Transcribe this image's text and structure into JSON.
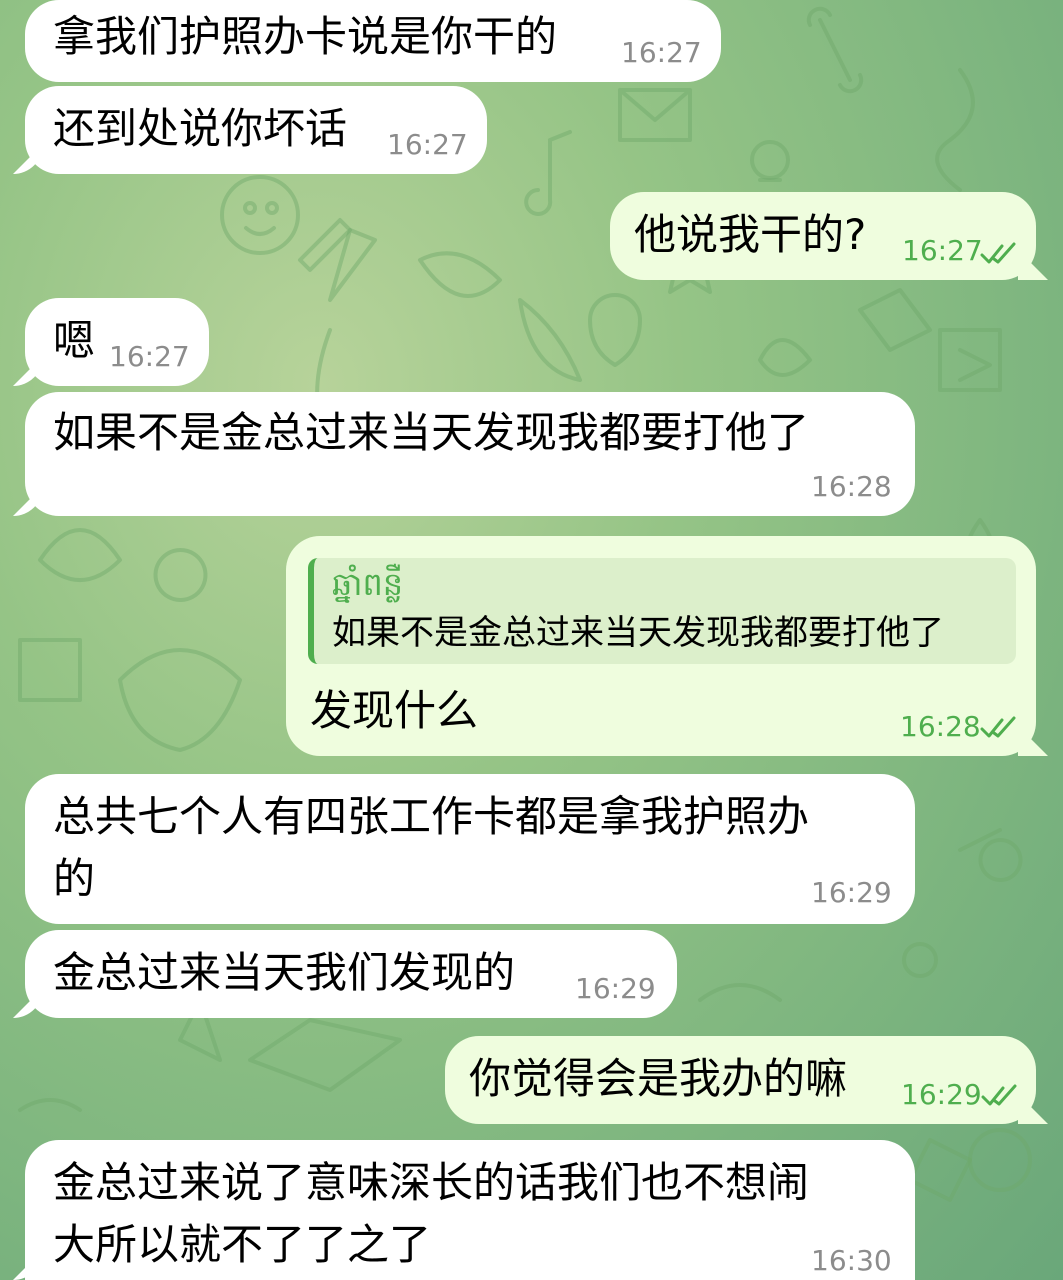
{
  "messages": [
    {
      "text": "拿我们护照办卡说是你干的",
      "time": "16:27"
    },
    {
      "text": "还到处说你坏话",
      "time": "16:27"
    },
    {
      "text": "他说我干的?",
      "time": "16:27"
    },
    {
      "text": "嗯",
      "time": "16:27"
    },
    {
      "text": "如果不是金总过来当天发现我都要打他了",
      "time": "16:28"
    },
    {
      "reply_name": "ឆ្នាំពន្លឺ",
      "reply_text": "如果不是金总过来当天发现我都要打他了",
      "text": "发现什么",
      "time": "16:28"
    },
    {
      "lines": [
        "总共七个人有四张工作卡都是拿我护照办",
        "的"
      ],
      "time": "16:29"
    },
    {
      "text": "金总过来当天我们发现的",
      "time": "16:29"
    },
    {
      "text": "你觉得会是我办的嘛",
      "time": "16:29"
    },
    {
      "lines": [
        "金总过来说了意味深长的话我们也不想闹",
        "大所以就不了了之了"
      ],
      "time": "16:30"
    }
  ],
  "colors": {
    "incoming_bubble": "#ffffff",
    "outgoing_bubble": "#effdde",
    "outgoing_time": "#4fae4e",
    "incoming_time": "#8c8c8c",
    "wallpaper": "#95c486"
  },
  "icons": {
    "read_status": "double-check-icon"
  }
}
